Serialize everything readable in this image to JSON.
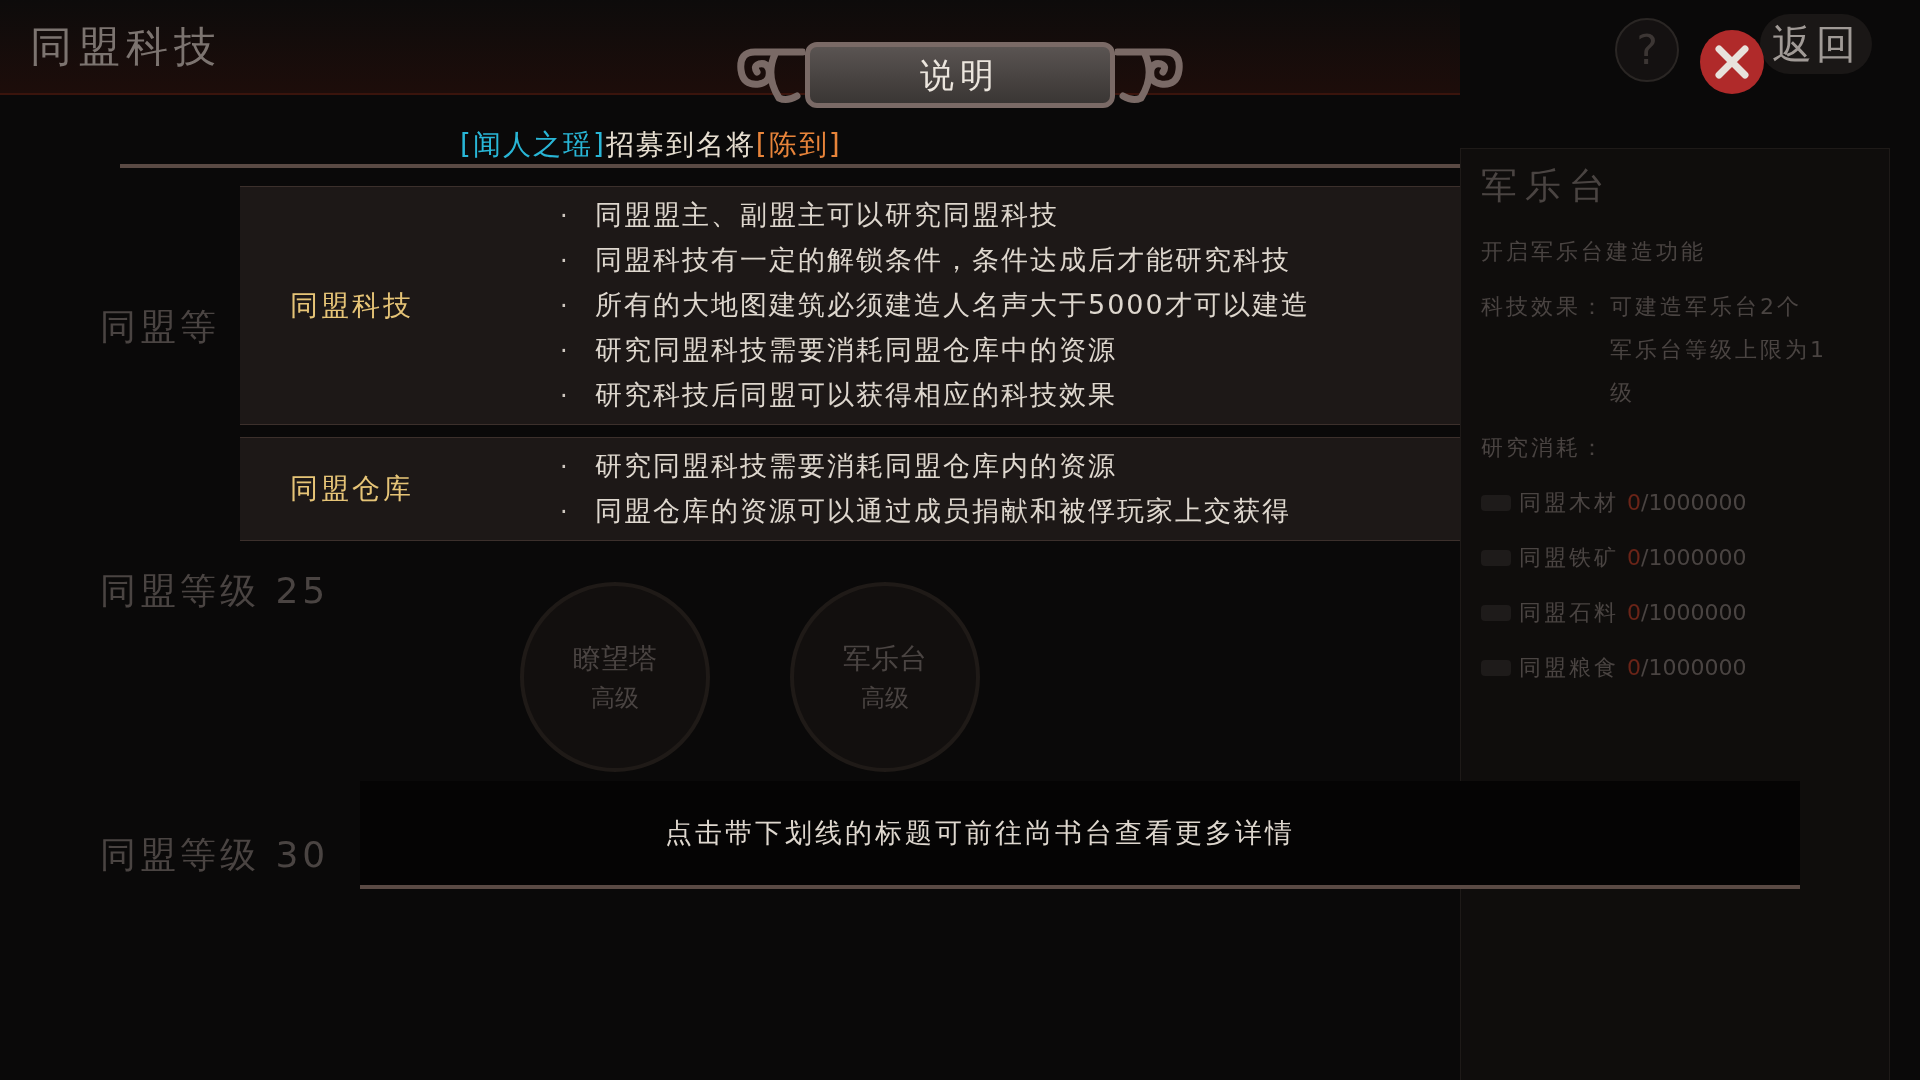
{
  "page_title": "同盟科技",
  "top_buttons": {
    "help": "?",
    "back": "返回"
  },
  "levels": [
    {
      "label": "同盟等"
    },
    {
      "label": "同盟等级 25"
    },
    {
      "label": "同盟等级 30"
    }
  ],
  "buildings": [
    {
      "name": "瞭望塔",
      "grade": "高级"
    },
    {
      "name": "军乐台",
      "grade": "高级"
    }
  ],
  "side_panel": {
    "title": "军乐台",
    "unlock": "开启军乐台建造功能",
    "effect_label": "科技效果：",
    "effect_lines": [
      "可建造军乐台2个",
      "军乐台等级上限为1",
      "级"
    ],
    "cost_label": "研究消耗：",
    "costs": [
      {
        "name": "同盟木材",
        "have": "0",
        "need": "/1000000"
      },
      {
        "name": "同盟铁矿",
        "have": "0",
        "need": "/1000000"
      },
      {
        "name": "同盟石料",
        "have": "0",
        "need": "/1000000"
      },
      {
        "name": "同盟粮食",
        "have": "0",
        "need": "/1000000"
      }
    ]
  },
  "dialog": {
    "title": "说明",
    "ticker": [
      {
        "text": "[闻人之瑶]",
        "color": "#29b6d6"
      },
      {
        "text": "招募到名将",
        "color": "#e6ded0"
      },
      {
        "text": "[陈到]",
        "color": "#e8843a"
      }
    ],
    "sections": [
      {
        "label": "同盟科技",
        "bullet": "·",
        "items": [
          "同盟盟主、副盟主可以研究同盟科技",
          "同盟科技有一定的解锁条件，条件达成后才能研究科技",
          "所有的大地图建筑必须建造人名声大于5000才可以建造",
          "研究同盟科技需要消耗同盟仓库中的资源",
          "研究科技后同盟可以获得相应的科技效果"
        ]
      },
      {
        "label": "同盟仓库",
        "bullet": "·",
        "items": [
          "研究同盟科技需要消耗同盟仓库内的资源",
          "同盟仓库的资源可以通过成员捐献和被俘玩家上交获得"
        ]
      }
    ],
    "footer": "点击带下划线的标题可前往尚书台查看更多详情"
  }
}
